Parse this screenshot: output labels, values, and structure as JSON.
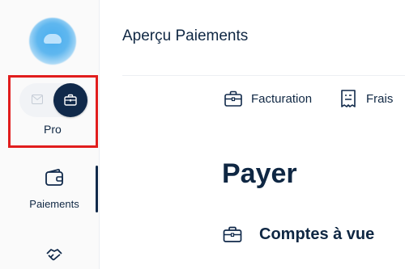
{
  "sidebar": {
    "logo_icon": "cloud-logo",
    "toggle": {
      "options": [
        "personal",
        "pro"
      ],
      "selected": "pro",
      "left_icon": "envelope-icon",
      "right_icon": "briefcase-icon",
      "label": "Pro"
    },
    "items": [
      {
        "label": "Paiements",
        "icon": "wallet-icon",
        "active": true
      },
      {
        "label": "",
        "icon": "handshake-icon",
        "active": false
      }
    ]
  },
  "header": {
    "title": "Aperçu Paiements"
  },
  "tabs": [
    {
      "label": "Facturation",
      "icon": "briefcase-icon"
    },
    {
      "label": "Frais",
      "icon": "receipt-icon"
    }
  ],
  "main": {
    "title": "Payer",
    "section": {
      "label": "Comptes à vue",
      "icon": "briefcase-icon"
    }
  },
  "colors": {
    "navy": "#10294a",
    "highlight": "#e11d1d",
    "logo_blue": "#4aaef0"
  }
}
